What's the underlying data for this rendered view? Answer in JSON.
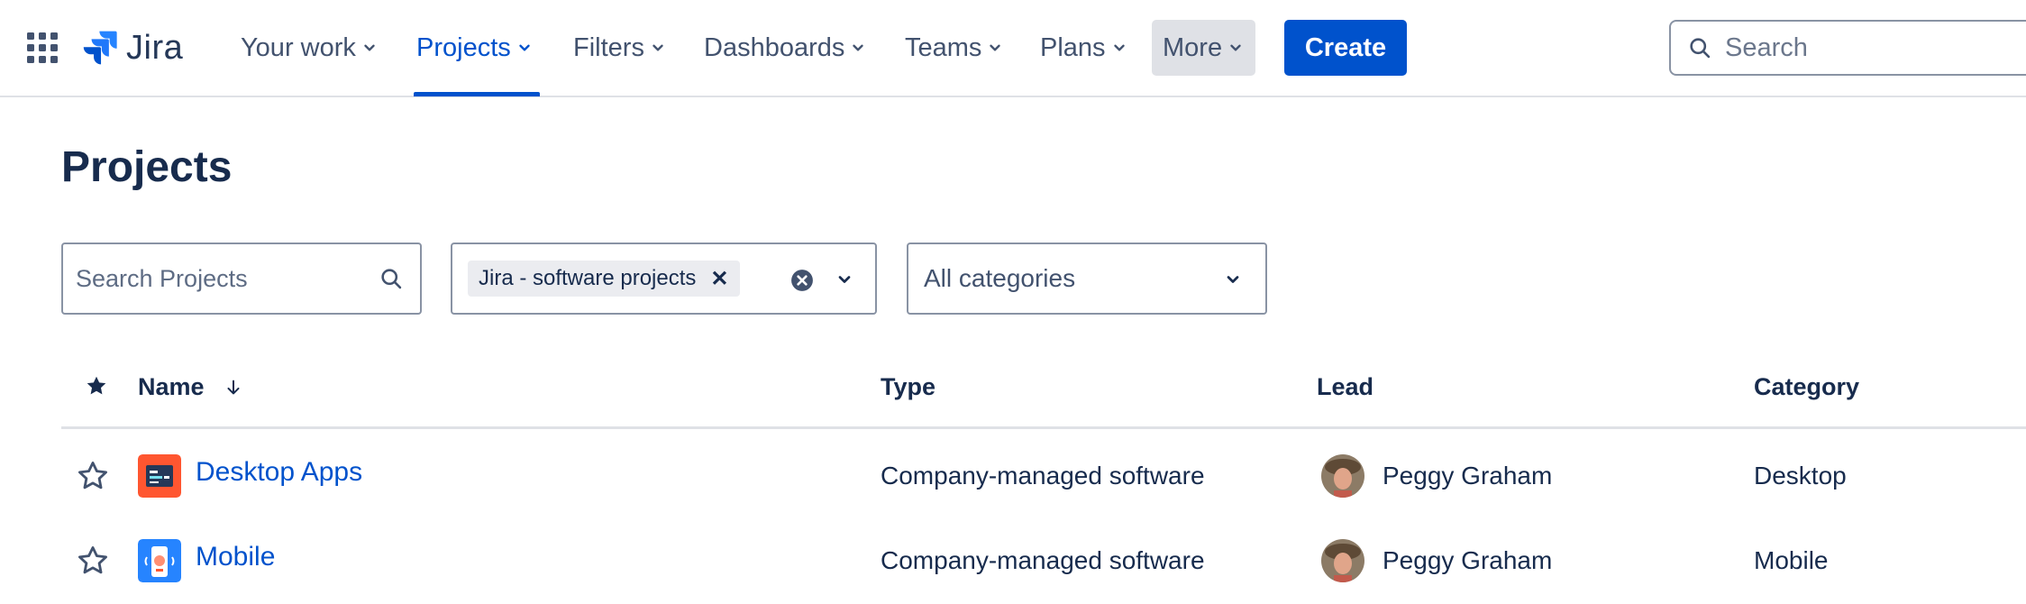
{
  "app": {
    "name": "Jira"
  },
  "nav": {
    "items": [
      {
        "label": "Your work"
      },
      {
        "label": "Projects",
        "active": true
      },
      {
        "label": "Filters"
      },
      {
        "label": "Dashboards"
      },
      {
        "label": "Teams"
      },
      {
        "label": "Plans"
      },
      {
        "label": "More"
      }
    ],
    "create_label": "Create",
    "search_placeholder": "Search"
  },
  "page": {
    "title": "Projects"
  },
  "filters": {
    "search_placeholder": "Search Projects",
    "product_tag": "Jira - software projects",
    "category_value": "All categories"
  },
  "table": {
    "columns": {
      "name": "Name",
      "type": "Type",
      "lead": "Lead",
      "category": "Category"
    },
    "sort": {
      "column": "Name",
      "direction": "descending-arrow"
    },
    "rows": [
      {
        "name": "Desktop Apps",
        "type": "Company-managed software",
        "lead": "Peggy Graham",
        "category": "Desktop",
        "icon": "desktop-app-icon",
        "starred": false
      },
      {
        "name": "Mobile",
        "type": "Company-managed software",
        "lead": "Peggy Graham",
        "category": "Mobile",
        "icon": "mobile-app-icon",
        "starred": false
      }
    ]
  },
  "colors": {
    "brand_blue": "#0052CC",
    "nav_text": "#42526E",
    "heading": "#172B4D",
    "border": "#8993A4",
    "divider": "#DFE1E6",
    "desktop_icon_bg": "#FF5630",
    "mobile_icon_bg": "#2684FF"
  }
}
